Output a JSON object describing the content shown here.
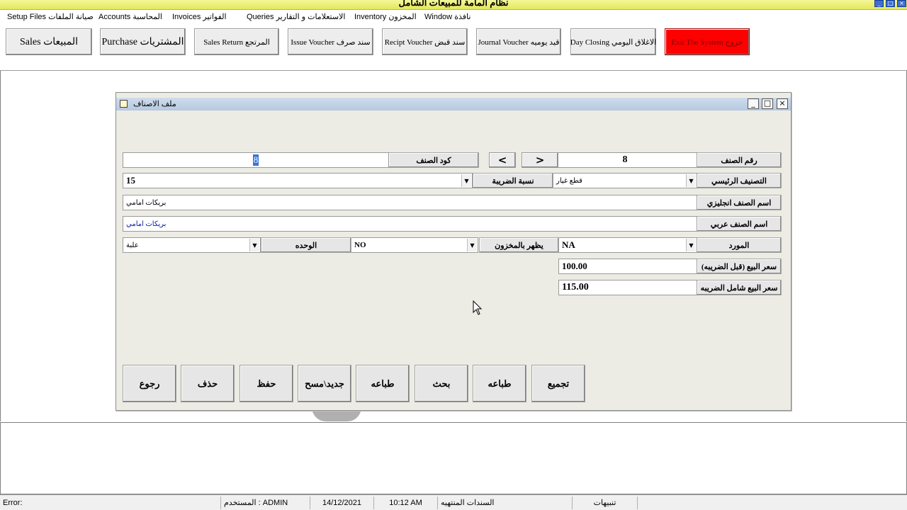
{
  "app": {
    "title": "نظام المامة للمبيعات الشامل",
    "window_controls": [
      "_",
      "□",
      "×"
    ]
  },
  "menu": [
    "Setup Files صيانة الملفات",
    "Accounts المحاسبة",
    "Invoices الفواتير",
    "Queries الاستعلامات و التقارير",
    "Inventory المخزون",
    "Window نافذة"
  ],
  "toolbar": [
    "Sales المبيعات",
    "Purchase المشتريات",
    "Sales Return المرتجع",
    "Issue Voucher سند صرف",
    "Recipt Voucher سند قبض",
    "Journal Voucher قيد يوميه",
    "Day Closing الاغلاق اليومي",
    "Exit The System خروج"
  ],
  "colors": {
    "exit_button": "#ff0000",
    "title_bar": "#e4e858",
    "dialog_title": "#b6c9e0"
  },
  "dialog": {
    "title": "ملف الاصناف",
    "controls": [
      "_",
      "□",
      "×"
    ],
    "item_number_label": "رقم الصنف",
    "item_number_value": "8",
    "nav_prev": "<",
    "nav_next": ">",
    "item_code_label": "كود الصنف",
    "item_code_value": "8",
    "main_category_label": "التصنيف الرئيسي",
    "main_category_value": "قطع غيار",
    "tax_rate_label": "نسبة الضريبة",
    "tax_rate_value": "15",
    "english_name_label": "اسم الصنف انجليزي",
    "english_name_value": "بريكات امامي",
    "arabic_name_label": "اسم الصنف عربي",
    "arabic_name_value": "بريكات امامي",
    "supplier_label": "المورد",
    "supplier_value": "NA",
    "show_in_stock_label": "يظهر بالمخزون",
    "show_in_stock_value": "NO",
    "unit_label": "الوحده",
    "unit_value": "علبة",
    "price_before_tax_label": "سعر البيع (قبل الضريبه)",
    "price_before_tax_value": "100.00",
    "price_with_tax_label": "سعر البيع شامل الضريبه",
    "price_with_tax_value": "115.00",
    "actions": [
      "رجوع",
      "حذف",
      "حفظ",
      "جديد\\مسح",
      "طباعه",
      "بحث",
      "طباعه",
      "تجميع"
    ]
  },
  "status": {
    "error": "Error:",
    "user": "ADMIN",
    "user_label": "المستخدم :",
    "date": "14/12/2021",
    "time": "10:12 AM",
    "expired_docs": "السندات المنتهيه",
    "alerts": "تنبيهات"
  }
}
